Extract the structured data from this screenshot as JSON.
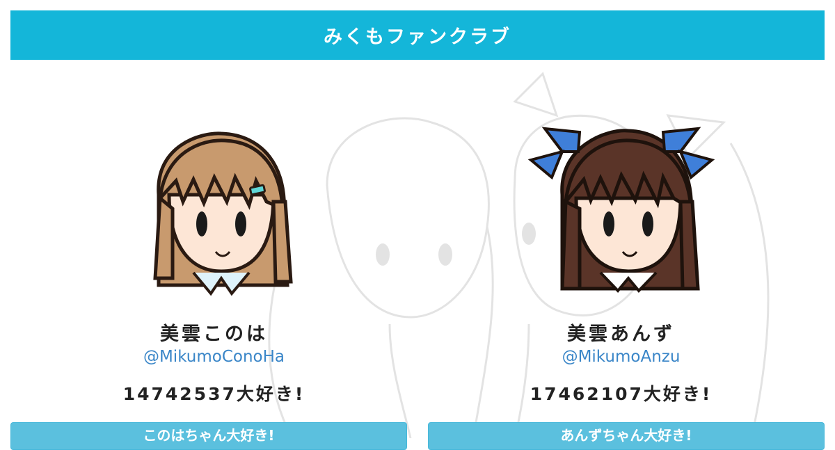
{
  "header": {
    "title": "みくもファンクラブ",
    "color": "#14b6d9"
  },
  "members": [
    {
      "name": "美雲このは",
      "handle": "@MikumoConoHa",
      "like_count_text": "14742537大好き!",
      "button_label": "このはちゃん大好き!",
      "hair_color": "#c89a6e",
      "accessory_color": "#5fd6d6"
    },
    {
      "name": "美雲あんず",
      "handle": "@MikumoAnzu",
      "like_count_text": "17462107大好き!",
      "button_label": "あんずちゃん大好き!",
      "hair_color": "#5a3428",
      "accessory_color": "#3f7fd9"
    }
  ]
}
